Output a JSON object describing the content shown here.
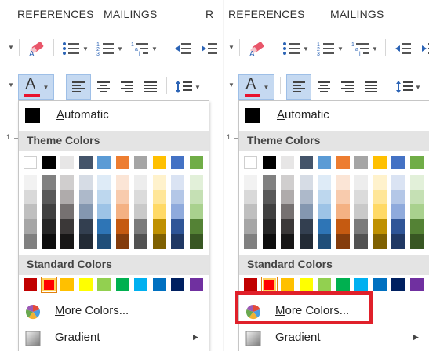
{
  "panels": [
    {
      "id": "left",
      "tabs": [
        "REFERENCES",
        "MAILINGS",
        "R"
      ],
      "show_highlight": false
    },
    {
      "id": "right",
      "tabs": [
        "REFERENCES",
        "MAILINGS"
      ],
      "show_highlight": true
    }
  ],
  "ribbon": {
    "font_color_letter": "A",
    "font_color_underline": "#e8112d",
    "ruler_mark": "1"
  },
  "dropdown": {
    "automatic_label": "Automatic",
    "automatic_swatch": "#000000",
    "theme_colors_label": "Theme Colors",
    "standard_colors_label": "Standard Colors",
    "more_colors_label": "More Colors...",
    "gradient_label": "Gradient",
    "theme_colors": [
      [
        "#ffffff",
        "#f2f2f2",
        "#d9d9d9",
        "#bfbfbf",
        "#a6a6a6",
        "#808080"
      ],
      [
        "#000000",
        "#808080",
        "#595959",
        "#404040",
        "#262626",
        "#0d0d0d"
      ],
      [
        "#e7e6e6",
        "#d0cece",
        "#afabab",
        "#767171",
        "#3b3838",
        "#171616"
      ],
      [
        "#44546a",
        "#d6dce5",
        "#adb9ca",
        "#8497b0",
        "#333f50",
        "#222a35"
      ],
      [
        "#5b9bd5",
        "#deebf7",
        "#bdd7ee",
        "#9dc3e6",
        "#2e75b6",
        "#1f4e79"
      ],
      [
        "#ed7d31",
        "#fbe5d6",
        "#f8cbad",
        "#f4b183",
        "#c55a11",
        "#843c0c"
      ],
      [
        "#a5a5a5",
        "#ededed",
        "#dbdbdb",
        "#c9c9c9",
        "#7b7b7b",
        "#525252"
      ],
      [
        "#ffc000",
        "#fff2cc",
        "#ffe699",
        "#ffd966",
        "#bf9000",
        "#7f6000"
      ],
      [
        "#4472c4",
        "#dae3f3",
        "#b4c7e7",
        "#8faadc",
        "#2f5597",
        "#203864"
      ],
      [
        "#70ad47",
        "#e2f0d9",
        "#c5e0b4",
        "#a9d18e",
        "#548235",
        "#385723"
      ]
    ],
    "standard_colors": [
      "#c00000",
      "#ff0000",
      "#ffc000",
      "#ffff00",
      "#92d050",
      "#00b050",
      "#00b0f0",
      "#0070c0",
      "#002060",
      "#7030a0"
    ],
    "selected_standard_index": 1
  }
}
